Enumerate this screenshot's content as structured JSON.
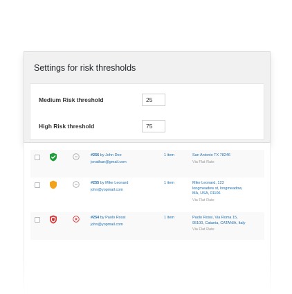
{
  "settings": {
    "title": "Settings for risk thresholds",
    "medium": {
      "label": "Medium Risk threshold",
      "value": "25"
    },
    "high": {
      "label": "High Risk threshold",
      "value": "75"
    }
  },
  "colors": {
    "low": "#1e9e3a",
    "medium": "#f2a31b",
    "high": "#d63638",
    "link": "#2271b1"
  },
  "orders": [
    {
      "risk": "low",
      "shield_icon": "shield-check-icon",
      "status_icon": "pending-minus-icon",
      "number": "#256",
      "by": "by John Doe",
      "email": "jonathan@gmail.com",
      "items": "1 item",
      "address": [
        "San Antonio TX 78246"
      ],
      "shipping": "Via Flat Rate"
    },
    {
      "risk": "medium",
      "shield_icon": "shield-warning-icon",
      "status_icon": "pending-minus-icon",
      "number": "#255",
      "by": "by Mike Leonard",
      "email": "john@yopmail.com",
      "items": "1 item",
      "address": [
        "Mike Leonard, 123",
        "longmeadow st, longmeadow,",
        "MA, USA, 01106"
      ],
      "shipping": "Via Flat Rate"
    },
    {
      "risk": "high",
      "shield_icon": "shield-danger-icon",
      "status_icon": "cancelled-x-icon",
      "number": "#254",
      "by": "by Paolo Rossi",
      "email": "john@yopmail.com",
      "items": "1 item",
      "address": [
        "Paolo Rossi, Via Roma 15,",
        "95100, Catania, CATANIA, Italy"
      ],
      "shipping": "Via Flat Rate"
    }
  ]
}
